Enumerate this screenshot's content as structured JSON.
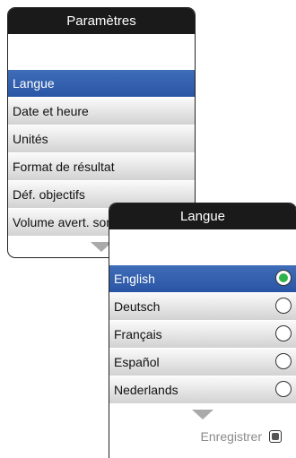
{
  "settings": {
    "title": "Paramètres",
    "items": [
      {
        "label": "Langue"
      },
      {
        "label": "Date et heure"
      },
      {
        "label": "Unités"
      },
      {
        "label": "Format de résultat"
      },
      {
        "label": "Déf. objectifs"
      },
      {
        "label": "Volume avert. sonore"
      }
    ],
    "selected_index": 0
  },
  "language": {
    "title": "Langue",
    "options": [
      {
        "label": "English",
        "checked": true
      },
      {
        "label": "Deutsch",
        "checked": false
      },
      {
        "label": "Français",
        "checked": false
      },
      {
        "label": "Español",
        "checked": false
      },
      {
        "label": "Nederlands",
        "checked": false
      }
    ],
    "save_label": "Enregistrer"
  },
  "colors": {
    "selection": "#2f5ca8",
    "radio_checked": "#2fb34a",
    "titlebar": "#1a1a1a"
  },
  "icons": {
    "scroll_down": "triangle-down-icon",
    "radio": "radio-icon",
    "save": "save-icon"
  }
}
